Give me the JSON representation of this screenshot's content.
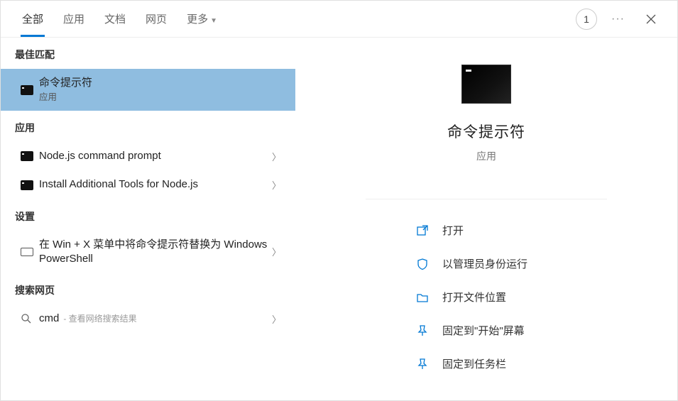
{
  "topbar": {
    "tabs": [
      {
        "label": "全部",
        "active": true
      },
      {
        "label": "应用"
      },
      {
        "label": "文档"
      },
      {
        "label": "网页"
      },
      {
        "label": "更多",
        "dropdown": true
      }
    ],
    "badge": "1"
  },
  "left": {
    "best_match_header": "最佳匹配",
    "best_match": {
      "label": "命令提示符",
      "sub": "应用"
    },
    "apps_header": "应用",
    "apps": [
      {
        "label": "Node.js command prompt"
      },
      {
        "label": "Install Additional Tools for Node.js"
      }
    ],
    "settings_header": "设置",
    "settings": [
      {
        "label": "在 Win + X 菜单中将命令提示符替换为 Windows PowerShell"
      }
    ],
    "web_header": "搜索网页",
    "web": {
      "query": "cmd",
      "hint": "- 查看网络搜索结果"
    }
  },
  "preview": {
    "title": "命令提示符",
    "sub": "应用",
    "actions": [
      {
        "icon": "open",
        "label": "打开"
      },
      {
        "icon": "admin",
        "label": "以管理员身份运行"
      },
      {
        "icon": "folder",
        "label": "打开文件位置"
      },
      {
        "icon": "pin-start",
        "label": "固定到\"开始\"屏幕"
      },
      {
        "icon": "pin-taskbar",
        "label": "固定到任务栏"
      }
    ]
  }
}
